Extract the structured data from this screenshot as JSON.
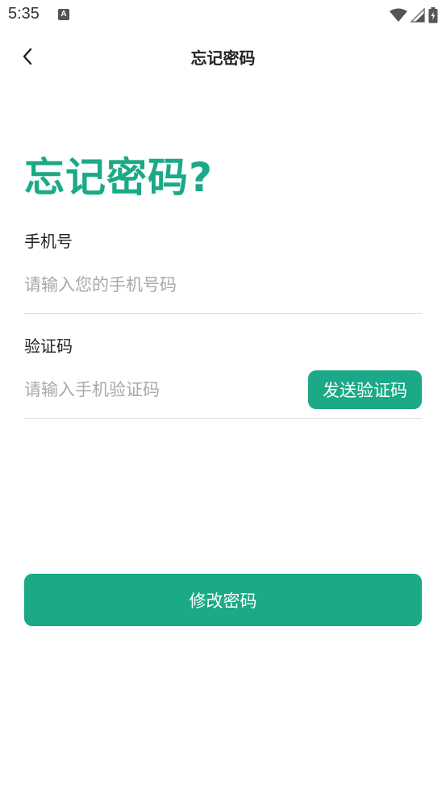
{
  "status_bar": {
    "time": "5:35",
    "notification_icon": "a-letter-icon",
    "icons": [
      "wifi-icon",
      "signal-icon",
      "battery-charging-icon"
    ]
  },
  "header": {
    "back_icon": "chevron-left-icon",
    "title": "忘记密码"
  },
  "form": {
    "heading": "忘记密码?",
    "phone": {
      "label": "手机号",
      "value": "",
      "placeholder": "请输入您的手机号码"
    },
    "code": {
      "label": "验证码",
      "value": "",
      "placeholder": "请输入手机验证码",
      "send_button_label": "发送验证码"
    },
    "submit_label": "修改密码"
  },
  "colors": {
    "accent": "#1ba987",
    "text": "#222222",
    "placeholder": "#a9a9a9",
    "divider": "#dedede"
  }
}
